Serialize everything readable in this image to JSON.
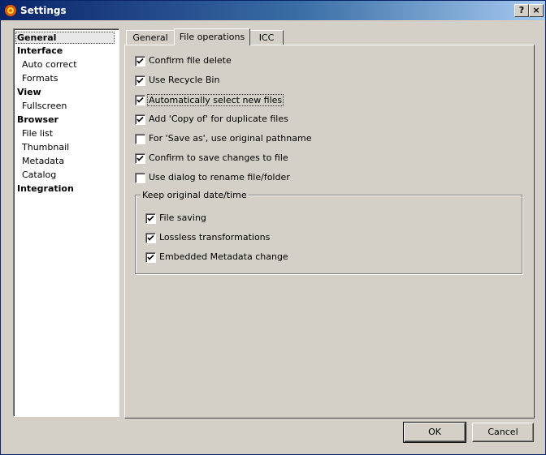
{
  "window": {
    "title": "Settings",
    "help_label": "?",
    "close_label": "×"
  },
  "sidebar": {
    "items": [
      {
        "label": "General",
        "kind": "cat",
        "selected": true
      },
      {
        "label": "Interface",
        "kind": "cat"
      },
      {
        "label": "Auto correct",
        "kind": "sub"
      },
      {
        "label": "Formats",
        "kind": "sub"
      },
      {
        "label": "View",
        "kind": "cat"
      },
      {
        "label": "Fullscreen",
        "kind": "sub"
      },
      {
        "label": "Browser",
        "kind": "cat"
      },
      {
        "label": "File list",
        "kind": "sub"
      },
      {
        "label": "Thumbnail",
        "kind": "sub"
      },
      {
        "label": "Metadata",
        "kind": "sub"
      },
      {
        "label": "Catalog",
        "kind": "sub"
      },
      {
        "label": "Integration",
        "kind": "cat"
      }
    ]
  },
  "tabs": [
    {
      "label": "General"
    },
    {
      "label": "File operations",
      "active": true
    },
    {
      "label": "ICC"
    }
  ],
  "options": [
    {
      "label": "Confirm file delete",
      "checked": true
    },
    {
      "label": "Use Recycle Bin",
      "checked": true
    },
    {
      "label": "Automatically select new files",
      "checked": true,
      "focused": true
    },
    {
      "label": "Add 'Copy of' for duplicate files",
      "checked": true
    },
    {
      "label": "For 'Save as', use original pathname",
      "checked": false
    },
    {
      "label": "Confirm to save changes to file",
      "checked": true
    },
    {
      "label": "Use dialog to rename file/folder",
      "checked": false
    }
  ],
  "date_group": {
    "title": "Keep original date/time",
    "options": [
      {
        "label": "File saving",
        "checked": true
      },
      {
        "label": "Lossless transformations",
        "checked": true
      },
      {
        "label": "Embedded Metadata change",
        "checked": true
      }
    ]
  },
  "buttons": {
    "ok_label": "OK",
    "cancel_label": "Cancel"
  }
}
